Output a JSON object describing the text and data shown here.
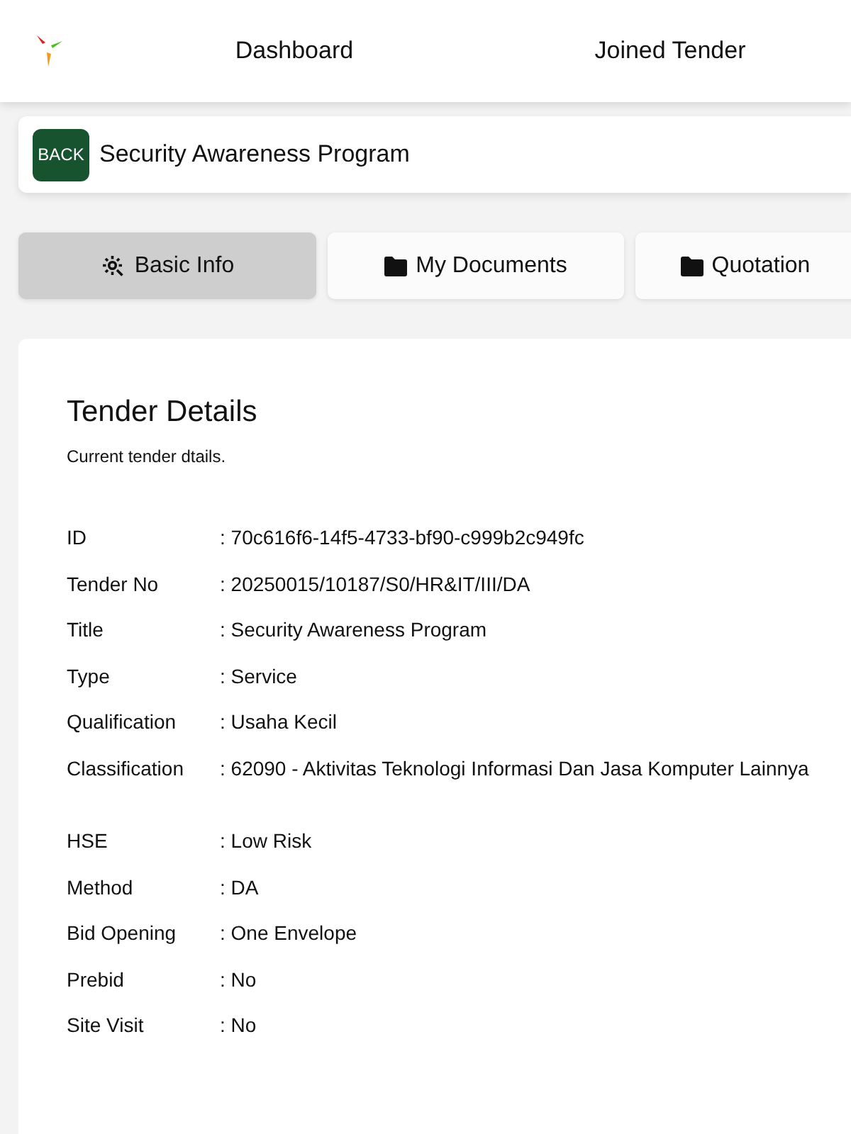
{
  "nav": {
    "links": [
      "Dashboard",
      "Joined Tender"
    ]
  },
  "title_bar": {
    "back_label": "BACK",
    "title": "Security Awareness Program"
  },
  "tabs": [
    {
      "label": "Basic Info",
      "kind": "gear",
      "selected": true
    },
    {
      "label": "My Documents",
      "kind": "folder",
      "selected": false
    },
    {
      "label": "Quotation",
      "kind": "folder",
      "selected": false
    }
  ],
  "details": {
    "heading": "Tender Details",
    "subtitle": "Current tender dtails.",
    "groups": [
      [
        {
          "label": "ID",
          "value": ": 70c616f6-14f5-4733-bf90-c999b2c949fc"
        },
        {
          "label": "Tender No",
          "value": ": 20250015/10187/S0/HR&IT/III/DA"
        },
        {
          "label": "Title",
          "value": ": Security Awareness Program"
        },
        {
          "label": "Type",
          "value": ": Service"
        },
        {
          "label": "Qualification",
          "value": ": Usaha Kecil"
        },
        {
          "label": "Classification",
          "value": ": 62090 - Aktivitas Teknologi Informasi Dan Jasa Komputer Lainnya"
        }
      ],
      [
        {
          "label": "HSE",
          "value": ": Low Risk"
        },
        {
          "label": "Method",
          "value": ": DA"
        },
        {
          "label": "Bid Opening",
          "value": ": One Envelope"
        },
        {
          "label": "Prebid",
          "value": ": No"
        },
        {
          "label": "Site Visit",
          "value": ": No"
        }
      ]
    ]
  }
}
